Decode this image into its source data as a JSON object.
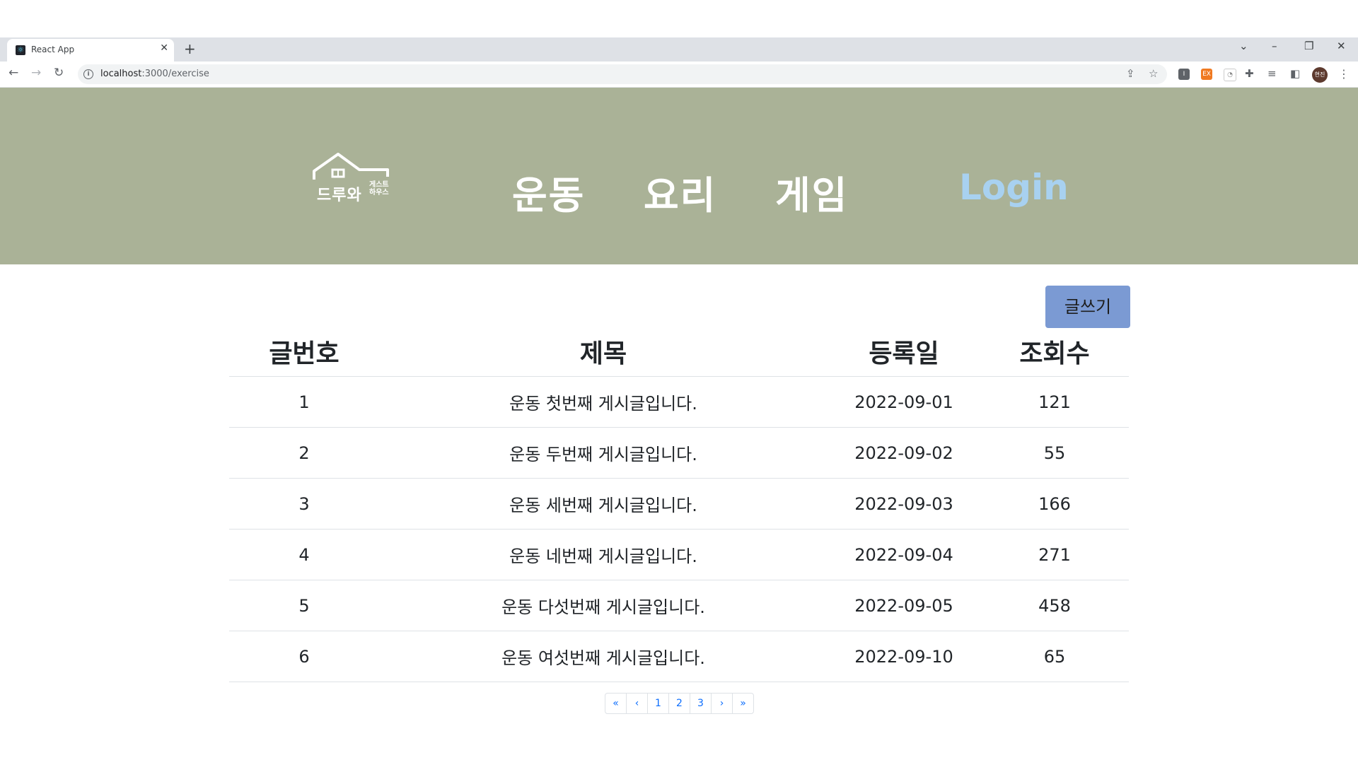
{
  "browser": {
    "tab_title": "React App",
    "url_host": "localhost",
    "url_path": ":3000/exercise",
    "profile_label": "현진"
  },
  "header": {
    "logo_text": "드루와",
    "logo_sub": "게스트 하우스",
    "nav": [
      "운동",
      "요리",
      "게임"
    ],
    "login_label": "Login"
  },
  "board": {
    "write_label": "글쓰기",
    "columns": [
      "글번호",
      "제목",
      "등록일",
      "조회수"
    ],
    "rows": [
      {
        "no": "1",
        "title": "운동 첫번째 게시글입니다.",
        "date": "2022-09-01",
        "views": "121"
      },
      {
        "no": "2",
        "title": "운동 두번째 게시글입니다.",
        "date": "2022-09-02",
        "views": "55"
      },
      {
        "no": "3",
        "title": "운동 세번째 게시글입니다.",
        "date": "2022-09-03",
        "views": "166"
      },
      {
        "no": "4",
        "title": "운동 네번째 게시글입니다.",
        "date": "2022-09-04",
        "views": "271"
      },
      {
        "no": "5",
        "title": "운동 다섯번째 게시글입니다.",
        "date": "2022-09-05",
        "views": "458"
      },
      {
        "no": "6",
        "title": "운동 여섯번째 게시글입니다.",
        "date": "2022-09-10",
        "views": "65"
      }
    ]
  },
  "pagination": {
    "first": "«",
    "prev": "‹",
    "pages": [
      "1",
      "2",
      "3"
    ],
    "next": "›",
    "last": "»"
  },
  "colors": {
    "header_bg": "#aab297",
    "login_color": "#a8d1f0",
    "write_button_bg": "#7b9ad3"
  }
}
